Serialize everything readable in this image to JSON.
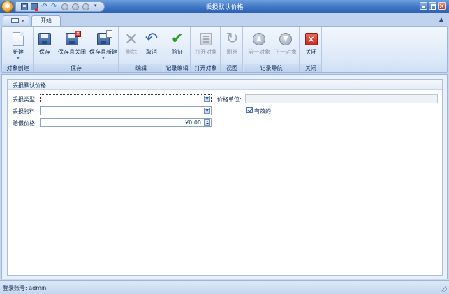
{
  "window": {
    "title": "丢损默认价格"
  },
  "quick_access": {
    "icons": [
      "app-menu-icon",
      "save-icon",
      "save-close-icon",
      "undo-icon",
      "redo-icon",
      "previous-icon",
      "next-icon",
      "more-icon"
    ]
  },
  "ribbon": {
    "tabs": [
      {
        "label": "开始"
      }
    ],
    "groups": {
      "create": {
        "label": "对象创建",
        "new_label": "新建"
      },
      "save": {
        "label": "保存",
        "save_label": "保存",
        "save_close_label": "保存且关闭",
        "save_new_label": "保存且新建"
      },
      "edit": {
        "label": "编辑",
        "delete_label": "删除",
        "cancel_label": "取消"
      },
      "record_edit": {
        "label": "记录编辑",
        "verify_label": "验证"
      },
      "open_object": {
        "label": "打开对象",
        "open_label": "打开对象"
      },
      "view": {
        "label": "视图",
        "refresh_label": "刷新"
      },
      "record_nav": {
        "label": "记录导航",
        "prev_label": "前一对象",
        "next_label": "下一对象"
      },
      "close": {
        "label": "关闭",
        "close_label": "关闭"
      }
    }
  },
  "form": {
    "section_title": "丢损默认价格",
    "loss_type": {
      "label": "丢损类型:",
      "value": ""
    },
    "loss_material": {
      "label": "丢损物料:",
      "value": ""
    },
    "compensation_price": {
      "label": "赔偿价格:",
      "value": "¥0.00"
    },
    "price_unit": {
      "label": "价格单位:",
      "value": ""
    },
    "valid": {
      "label": "有效的",
      "checked": true
    }
  },
  "status_bar": {
    "login_text": "登录账号: admin"
  },
  "colors": {
    "title_bar": "#3f77c7",
    "ribbon_bg": "#dde9f8",
    "verify_check": "#2f9b2a",
    "close_red": "#c42a1c"
  }
}
